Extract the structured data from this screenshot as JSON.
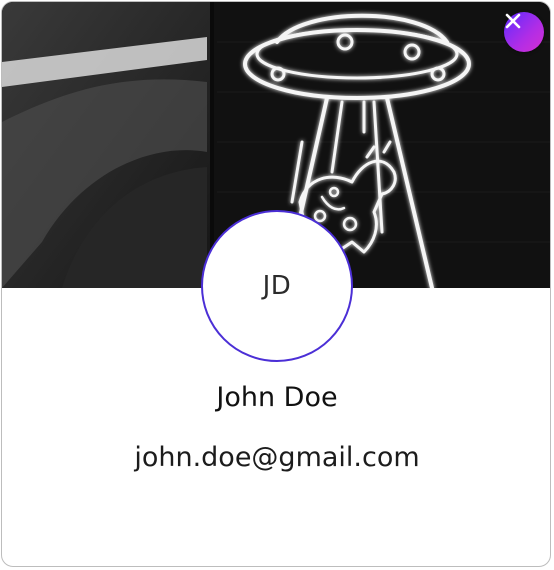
{
  "profile": {
    "initials": "JD",
    "name": "John Doe",
    "email": "john.doe@gmail.com"
  },
  "close_button": {
    "icon": "close-icon"
  },
  "cover_image": {
    "subject": "neon-ufo-abducting-cow"
  },
  "colors": {
    "avatar_border": "#4b2fd6",
    "close_gradient_start": "#5d2cff",
    "close_gradient_end": "#d42fd2",
    "card_border": "#bdbdbd"
  }
}
